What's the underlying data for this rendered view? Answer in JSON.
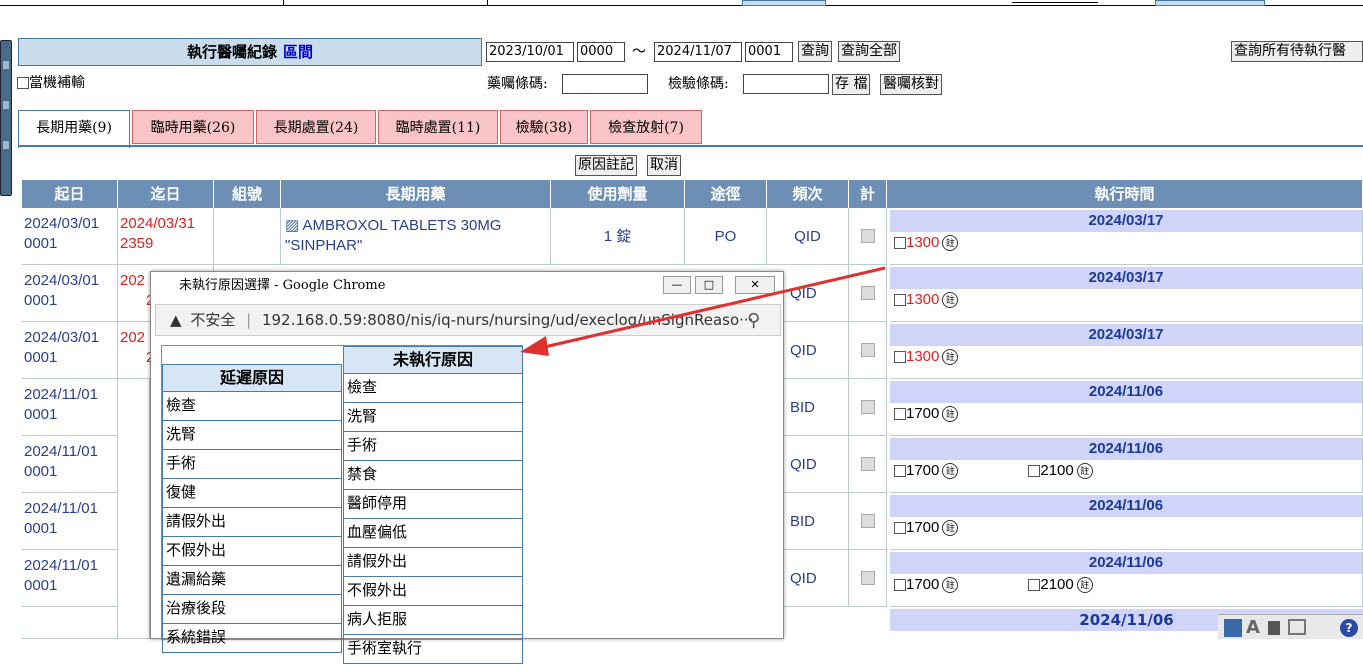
{
  "header": {
    "title": "執行醫囑紀錄",
    "title_highlight": "區間",
    "start_date": "2023/10/01",
    "start_time": "0000",
    "tilde": "～",
    "end_date": "2024/11/07",
    "end_time": "0001",
    "query_label": "查詢",
    "query_all_label": "查詢全部",
    "query_pending_label": "查詢所有待執行醫",
    "standby_label": "當機補輸",
    "med_barcode_label": "藥囑條碼:",
    "exam_barcode_label": "檢驗條碼:",
    "save_label": "存 檔",
    "verify_label": "醫囑核對"
  },
  "tabs": [
    {
      "label": "長期用藥(9)",
      "active": true
    },
    {
      "label": "臨時用藥(26)",
      "active": false
    },
    {
      "label": "長期處置(24)",
      "active": false
    },
    {
      "label": "臨時處置(11)",
      "active": false
    },
    {
      "label": "檢驗(38)",
      "active": false
    },
    {
      "label": "檢查放射(7)",
      "active": false
    }
  ],
  "reason_note_label": "原因註記",
  "cancel_label": "取消",
  "table": {
    "columns": [
      "起日",
      "迄日",
      "組號",
      "長期用藥",
      "使用劑量",
      "途徑",
      "頻次",
      "計",
      "執行時間"
    ],
    "rows": [
      {
        "start": "2024/03/01",
        "start_t": "0001",
        "end": "2024/03/31",
        "end_t": "2359",
        "drug": "AMBROXOL TABLETS 30MG \"SINPHAR\"",
        "dose": "1 錠",
        "route": "PO",
        "freq": "QID",
        "exec_date": "2024/03/17",
        "times": [
          "1300"
        ]
      },
      {
        "start": "2024/03/01",
        "start_t": "0001",
        "end": "202",
        "end_t": "2",
        "freq": "QID",
        "exec_date": "2024/03/17",
        "times": [
          "1300"
        ]
      },
      {
        "start": "2024/03/01",
        "start_t": "0001",
        "end": "202",
        "end_t": "2",
        "freq": "QID",
        "exec_date": "2024/03/17",
        "times": [
          "1300"
        ]
      },
      {
        "start": "2024/11/01",
        "start_t": "0001",
        "freq": "BID",
        "exec_date": "2024/11/06",
        "times": [
          "1700"
        ]
      },
      {
        "start": "2024/11/01",
        "start_t": "0001",
        "freq": "QID",
        "exec_date": "2024/11/06",
        "times": [
          "1700",
          "2100"
        ]
      },
      {
        "start": "2024/11/01",
        "start_t": "0001",
        "freq": "BID",
        "exec_date": "2024/11/06",
        "times": [
          "1700"
        ]
      },
      {
        "start": "2024/11/01",
        "start_t": "0001",
        "freq": "QID",
        "exec_date": "2024/11/06",
        "times": [
          "1700",
          "2100"
        ]
      },
      {
        "exec_date": "2024/11/06"
      }
    ]
  },
  "note_glyph": "註",
  "popup": {
    "title": "未執行原因選擇 - Google Chrome",
    "insecure_label": "不安全",
    "url": "192.168.0.59:8080/nis/iq-nurs/nursing/ud/execlog/unSignReaso···",
    "delay_header": "延遲原因",
    "delay_items": [
      "檢查",
      "洗腎",
      "手術",
      "復健",
      "請假外出",
      "不假外出",
      "遺漏給藥",
      "治療後段",
      "系統錯誤"
    ],
    "unexec_header": "未執行原因",
    "unexec_items": [
      "檢查",
      "洗腎",
      "手術",
      "禁食",
      "醫師停用",
      "血壓偏低",
      "請假外出",
      "不假外出",
      "病人拒服",
      "手術室執行"
    ]
  },
  "colors": {
    "header_bg": "#6d8fb5",
    "tab_pink": "#f8c4c8",
    "arrow": "#e03030",
    "date_red": "#d22222"
  }
}
